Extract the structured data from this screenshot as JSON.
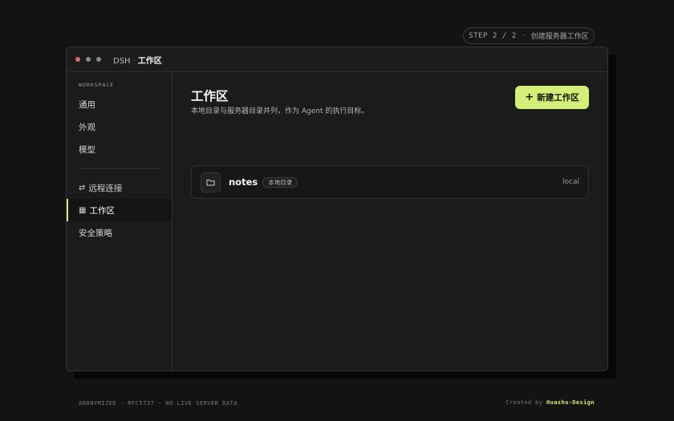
{
  "step": {
    "prefix": "STEP",
    "current": "2",
    "slash": "/",
    "total": "2",
    "dot": "·",
    "label": "创建服务器工作区"
  },
  "window": {
    "app": "DSH",
    "separator": "·",
    "section": "工作区"
  },
  "sidebar": {
    "section_label": "WORKSPACE",
    "items": [
      {
        "label": "通用",
        "icon": ""
      },
      {
        "label": "外观",
        "icon": ""
      },
      {
        "label": "模型",
        "icon": ""
      },
      {
        "label": "远程连接",
        "icon": "⇄"
      },
      {
        "label": "工作区",
        "icon": "▦"
      },
      {
        "label": "安全策略",
        "icon": ""
      }
    ],
    "active_index": 4
  },
  "main": {
    "title": "工作区",
    "subtitle": "本地目录与服务器目录并列，作为 Agent 的执行目标。",
    "new_button": {
      "plus": "+",
      "label": "新建工作区"
    },
    "workspaces": [
      {
        "name": "notes",
        "badge": "本地目录",
        "type": "local",
        "icon": "folder-icon"
      }
    ]
  },
  "footer": {
    "left": "ANONYMIZED · RFC5737 · NO LIVE SERVER DATA",
    "right_prefix": "Created by",
    "right_brand": "Huashu-Design"
  },
  "colors": {
    "accent": "#d3ef77",
    "background": "#131313",
    "window": "#1b1b1b",
    "traffic_red": "#e36a6a"
  }
}
